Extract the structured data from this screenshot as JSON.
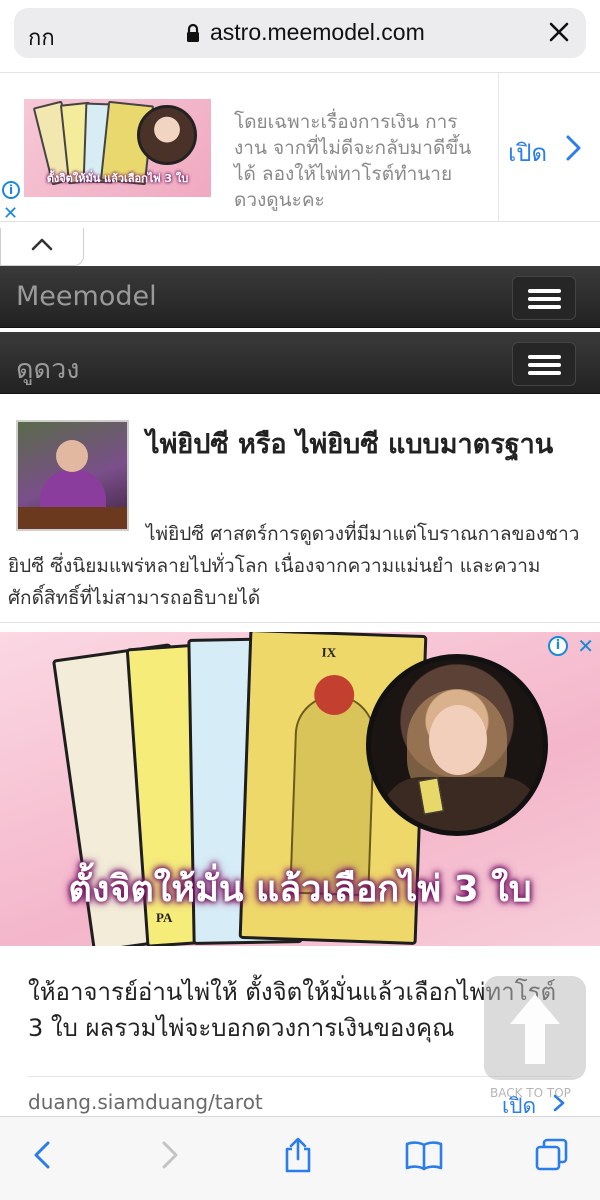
{
  "browser": {
    "aa_label": "กก",
    "url": "astro.meemodel.com"
  },
  "top_ad": {
    "image_caption": "ตั้งจิตให้มั่น แล้วเลือกไพ่ 3 ใบ",
    "text": "โดยเฉพาะเรื่องการเงิน การงาน จากที่ไม่ดีจะกลับมาดีขึ้นได้ ลองให้ไพ่ทาโรต์ทำนายดวงดูนะคะ",
    "open_label": "เปิด"
  },
  "nav": {
    "brand": "Meemodel",
    "section": "ดูดวง"
  },
  "article": {
    "title": "ไพ่ยิปซี หรือ ไพ่ยิบซี แบบมาตรฐาน",
    "body": "ไพ่ยิปซี ศาสตร์การดูดวงที่มีมาแต่โบราณกาลของชาวยิปซี ซึ่งนิยมแพร่หลายไปทั่วโลก เนื่องจากความแม่นยำ และความศักดิ์สิทธิ์ที่ไม่สามารถอธิบายได้"
  },
  "big_ad": {
    "image_caption": "ตั้งจิตให้มั่น แล้วเลือกไพ่ 3 ใบ",
    "card_numeral": "IX",
    "card_label": "PA",
    "text": "ให้อาจารย์อ่านไพ่ให้ ตั้งจิตให้มั่นแล้วเลือกไพ่ทาโรต์ 3 ใบ ผลรวมไพ่จะบอกดวงการเงินของคุณ",
    "domain": "duang.siamduang/tarot",
    "open_label": "เปิด"
  },
  "back_to_top": {
    "label": "BACK TO TOP"
  },
  "colors": {
    "link_blue": "#2b7de9",
    "navbar_dark": "#2a2a2a"
  },
  "toolbar": {
    "icons": [
      "back-icon",
      "forward-icon",
      "share-icon",
      "bookmarks-icon",
      "tabs-icon"
    ]
  }
}
